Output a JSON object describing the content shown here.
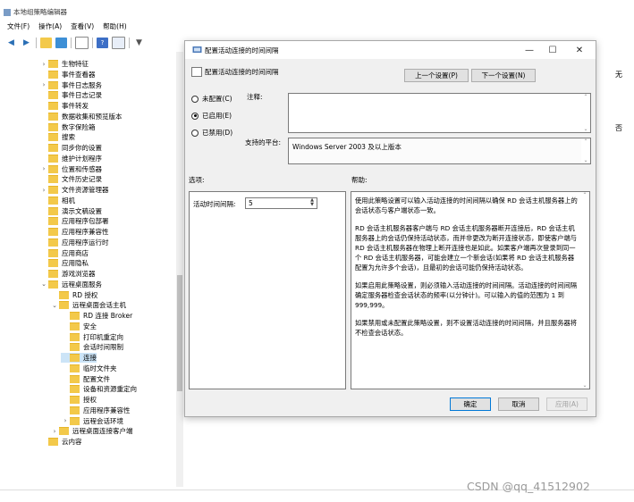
{
  "window": {
    "title": "本地组策略编辑器"
  },
  "menu": [
    "文件(F)",
    "操作(A)",
    "查看(V)",
    "帮助(H)"
  ],
  "tree": {
    "items": [
      {
        "label": "生物特征",
        "indent": 0,
        "chev": "›"
      },
      {
        "label": "事件查看器",
        "indent": 0,
        "chev": ""
      },
      {
        "label": "事件日志服务",
        "indent": 0,
        "chev": "›"
      },
      {
        "label": "事件日志记录",
        "indent": 0,
        "chev": ""
      },
      {
        "label": "事件转发",
        "indent": 0,
        "chev": ""
      },
      {
        "label": "数据收集和预览版本",
        "indent": 0,
        "chev": ""
      },
      {
        "label": "数字保险箱",
        "indent": 0,
        "chev": ""
      },
      {
        "label": "搜索",
        "indent": 0,
        "chev": ""
      },
      {
        "label": "同步你的设置",
        "indent": 0,
        "chev": ""
      },
      {
        "label": "维护计划程序",
        "indent": 0,
        "chev": ""
      },
      {
        "label": "位置和传感器",
        "indent": 0,
        "chev": "›"
      },
      {
        "label": "文件历史记录",
        "indent": 0,
        "chev": ""
      },
      {
        "label": "文件资源管理器",
        "indent": 0,
        "chev": "›"
      },
      {
        "label": "相机",
        "indent": 0,
        "chev": ""
      },
      {
        "label": "演示文稿设置",
        "indent": 0,
        "chev": ""
      },
      {
        "label": "应用程序包部署",
        "indent": 0,
        "chev": ""
      },
      {
        "label": "应用程序兼容性",
        "indent": 0,
        "chev": ""
      },
      {
        "label": "应用程序运行时",
        "indent": 0,
        "chev": ""
      },
      {
        "label": "应用商店",
        "indent": 0,
        "chev": ""
      },
      {
        "label": "应用隐私",
        "indent": 0,
        "chev": ""
      },
      {
        "label": "游戏浏览器",
        "indent": 0,
        "chev": ""
      },
      {
        "label": "远程桌面服务",
        "indent": 0,
        "chev": "⌄"
      },
      {
        "label": "RD 授权",
        "indent": 1,
        "chev": ""
      },
      {
        "label": "远程桌面会话主机",
        "indent": 1,
        "chev": "⌄"
      },
      {
        "label": "RD 连接 Broker",
        "indent": 2,
        "chev": ""
      },
      {
        "label": "安全",
        "indent": 2,
        "chev": ""
      },
      {
        "label": "打印机重定向",
        "indent": 2,
        "chev": ""
      },
      {
        "label": "会话时间限制",
        "indent": 2,
        "chev": ""
      },
      {
        "label": "连接",
        "indent": 2,
        "chev": "",
        "selected": true
      },
      {
        "label": "临时文件夹",
        "indent": 2,
        "chev": ""
      },
      {
        "label": "配置文件",
        "indent": 2,
        "chev": ""
      },
      {
        "label": "设备和资源重定向",
        "indent": 2,
        "chev": ""
      },
      {
        "label": "授权",
        "indent": 2,
        "chev": ""
      },
      {
        "label": "应用程序兼容性",
        "indent": 2,
        "chev": ""
      },
      {
        "label": "远程会话环境",
        "indent": 2,
        "chev": "›"
      },
      {
        "label": "远程桌面连接客户端",
        "indent": 1,
        "chev": "›"
      },
      {
        "label": "云内容",
        "indent": 0,
        "chev": ""
      }
    ]
  },
  "dialog": {
    "title": "配置活动连接的时间间隔",
    "header": "配置活动连接的时间间隔",
    "prev_button": "上一个设置(P)",
    "next_button": "下一个设置(N)",
    "radio_not_configured": "未配置(C)",
    "radio_enabled": "已启用(E)",
    "radio_disabled": "已禁用(D)",
    "comment_label": "注释:",
    "platform_label": "支持的平台:",
    "platform_value": "Windows Server 2003 及以上版本",
    "options_label": "选项:",
    "help_label": "帮助:",
    "interval_label": "活动时间间隔:",
    "interval_value": "5",
    "help_paragraphs": [
      "使用此策略设置可以输入活动连接的时间间隔以确保 RD 会话主机服务器上的会话状态与客户端状态一致。",
      "RD 会话主机服务器客户端与 RD 会话主机服务器断开连接后，RD 会话主机服务器上的会话仍保持活动状态，而并非更改为断开连接状态，即使客户端与 RD 会话主机服务器在物理上断开连接也是如此。如果客户端再次登录到同一个 RD 会话主机服务器，可能会建立一个新会话(如果将 RD 会话主机服务器配置为允许多个会话)，且最初的会话可能仍保持活动状态。",
      "如果启用此策略设置，则必须输入活动连接的时间间隔。活动连接的时间间隔确定服务器检查会话状态的频率(以分钟计)。可以输入的值的范围为 1 到 999,999。",
      "如果禁用或未配置此策略设置，则不设置活动连接的时间间隔，并且服务器将不检查会话状态。"
    ],
    "ok_button": "确定",
    "cancel_button": "取消",
    "apply_button": "应用(A)"
  },
  "watermark": "CSDN @qq_41512902",
  "colors": {
    "accent": "#0078d7",
    "folder": "#f3c94a",
    "selection": "#cce4f7"
  }
}
